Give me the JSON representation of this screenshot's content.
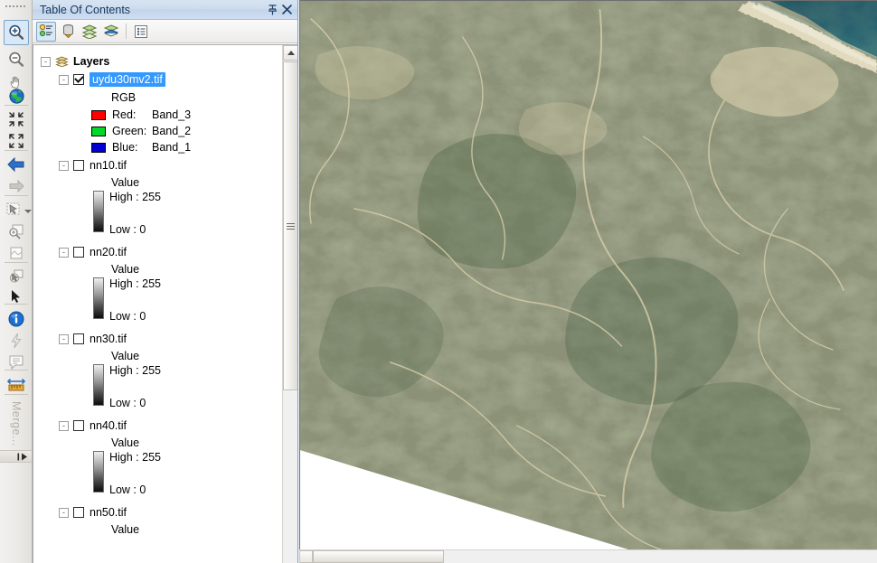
{
  "panel": {
    "title": "Table Of Contents",
    "pin_icon": "pin-icon",
    "close_icon": "close-icon",
    "toolbar": [
      {
        "name": "list-by-drawing-order",
        "label": "List By Drawing Order",
        "selected": true
      },
      {
        "name": "list-by-source",
        "label": "List By Source",
        "selected": false
      },
      {
        "name": "list-by-visibility",
        "label": "List By Visibility",
        "selected": false
      },
      {
        "name": "list-by-selection",
        "label": "List By Selection",
        "selected": false
      },
      {
        "name": "toc-options",
        "label": "Options",
        "selected": false
      }
    ]
  },
  "tree": {
    "root": {
      "label": "Layers",
      "expander": "-"
    },
    "layers": [
      {
        "name": "uydu30mv2.tif",
        "checked": true,
        "selected": true,
        "expander": "-",
        "renderer": "RGB",
        "bands": [
          {
            "channel": "Red:",
            "band": "Band_3",
            "color": "#ff0000"
          },
          {
            "channel": "Green:",
            "band": "Band_2",
            "color": "#00d82b"
          },
          {
            "channel": "Blue:",
            "band": "Band_1",
            "color": "#0000d2"
          }
        ]
      },
      {
        "name": "nn10.tif",
        "checked": false,
        "selected": false,
        "expander": "-",
        "value_label": "Value",
        "high": "High : 255",
        "low": "Low : 0"
      },
      {
        "name": "nn20.tif",
        "checked": false,
        "selected": false,
        "expander": "-",
        "value_label": "Value",
        "high": "High : 255",
        "low": "Low : 0"
      },
      {
        "name": "nn30.tif",
        "checked": false,
        "selected": false,
        "expander": "-",
        "value_label": "Value",
        "high": "High : 255",
        "low": "Low : 0"
      },
      {
        "name": "nn40.tif",
        "checked": false,
        "selected": false,
        "expander": "-",
        "value_label": "Value",
        "high": "High : 255",
        "low": "Low : 0"
      },
      {
        "name": "nn50.tif",
        "checked": false,
        "selected": false,
        "expander": "-",
        "value_label": "Value",
        "high": "",
        "low": ""
      }
    ]
  },
  "tools": [
    {
      "name": "zoom-in-tool",
      "icon": "magnifier-plus-icon",
      "selected": true
    },
    {
      "name": "zoom-out-tool",
      "icon": "magnifier-minus-icon",
      "selected": false
    },
    {
      "name": "pan-tool",
      "icon": "hand-icon",
      "selected": false
    },
    {
      "name": "full-extent-tool",
      "icon": "globe-icon",
      "selected": false
    },
    {
      "name": "fixed-zoom-in-tool",
      "icon": "arrows-in-icon",
      "selected": false
    },
    {
      "name": "fixed-zoom-out-tool",
      "icon": "arrows-out-icon",
      "selected": false
    },
    {
      "name": "go-back-extent",
      "icon": "arrow-left-icon",
      "selected": false
    },
    {
      "name": "go-next-extent",
      "icon": "arrow-right-icon",
      "selected": false
    },
    {
      "name": "select-features",
      "icon": "select-features-icon",
      "selected": false
    },
    {
      "name": "select-by-rectangle",
      "icon": "zoom-select-icon",
      "selected": false
    },
    {
      "name": "clear-selection",
      "icon": "clear-selection-icon",
      "selected": false
    },
    {
      "name": "select-elements",
      "icon": "select-graphics-icon",
      "selected": false
    },
    {
      "name": "arrow-pointer-tool",
      "icon": "cursor-arrow-icon",
      "selected": false
    },
    {
      "name": "identify-tool",
      "icon": "info-circle-icon",
      "selected": false
    },
    {
      "name": "hyperlink-tool",
      "icon": "lightning-icon",
      "selected": false
    },
    {
      "name": "html-popup-tool",
      "icon": "popup-icon",
      "selected": false
    },
    {
      "name": "measure-tool",
      "icon": "ruler-icon",
      "selected": false
    }
  ],
  "merge_label": "Merge...",
  "strip_expand_icon": "expand-toolbar-icon",
  "map": {
    "name": "data-frame",
    "water_color": "#2f6e7b",
    "beach_color": "#e4dcc4",
    "vegetation_color": "#6e7e5c",
    "soil_color": "#e8ddc2",
    "nodata_color": "#ffffff"
  },
  "scrollbars": {
    "toc_vertical": {
      "up_arrow": "scroll-up-icon",
      "grip": "thumb-grip"
    },
    "map_horizontal": {
      "left_arrow": "scroll-left-icon",
      "right_arrow": "scroll-right-icon"
    }
  }
}
